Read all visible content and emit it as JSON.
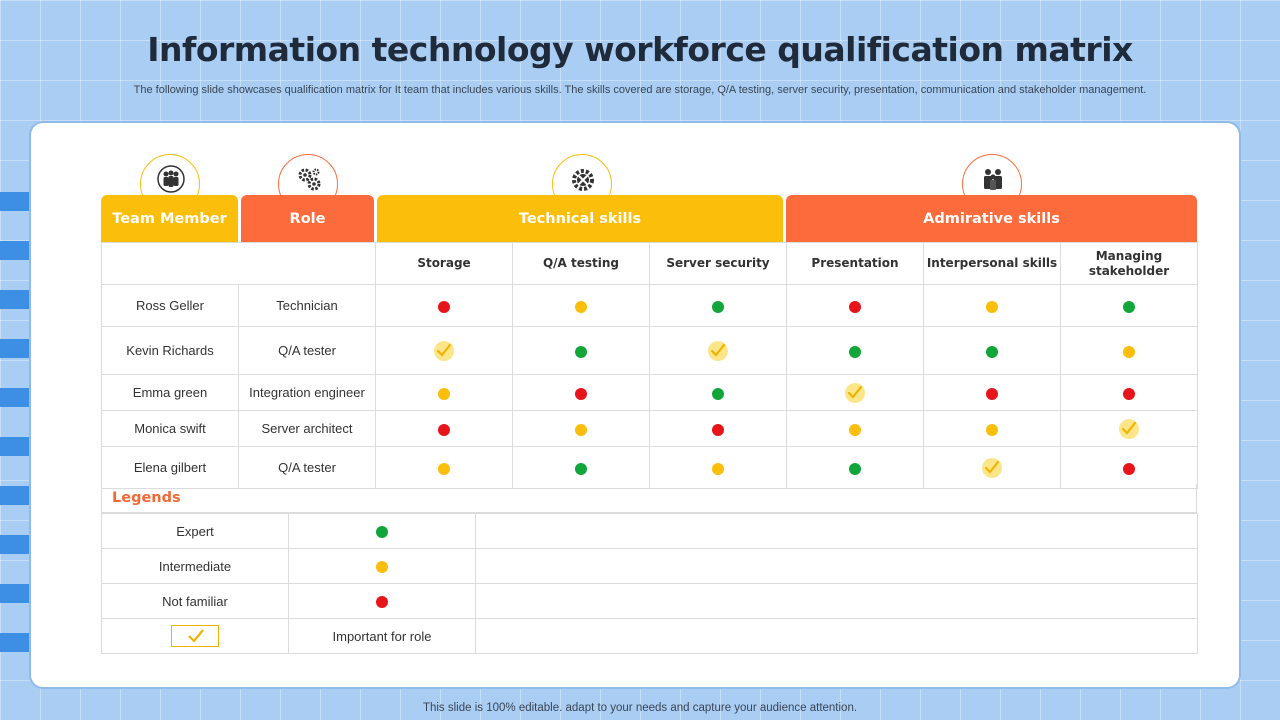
{
  "title": "Information technology workforce qualification matrix",
  "subtitle": "The following slide showcases qualification matrix for It team that includes various skills. The skills covered are storage, Q/A testing, server security, presentation, communication and stakeholder management.",
  "footer": "This slide is 100% editable. adapt to your needs and capture your audience attention.",
  "headers": {
    "team_member": "Team Member",
    "role": "Role",
    "technical": "Technical skills",
    "admin": "Admirative skills"
  },
  "skills": [
    "Storage",
    "Q/A testing",
    "Server security",
    "Presentation",
    "Interpersonal skills",
    "Managing stakeholder"
  ],
  "rows": [
    {
      "name": "Ross Geller",
      "role": "Technician",
      "levels": [
        "notfamiliar",
        "intermediate",
        "expert",
        "notfamiliar",
        "intermediate",
        "expert"
      ]
    },
    {
      "name": "Kevin Richards",
      "role": "Q/A tester",
      "levels": [
        "check",
        "expert",
        "check",
        "expert",
        "expert",
        "intermediate"
      ]
    },
    {
      "name": "Emma green",
      "role": "Integration  engineer",
      "levels": [
        "intermediate",
        "notfamiliar",
        "expert",
        "check",
        "notfamiliar",
        "notfamiliar"
      ]
    },
    {
      "name": "Monica swift",
      "role": "Server  architect",
      "levels": [
        "notfamiliar",
        "intermediate",
        "notfamiliar",
        "intermediate",
        "intermediate",
        "check"
      ]
    },
    {
      "name": "Elena gilbert",
      "role": "Q/A tester",
      "levels": [
        "intermediate",
        "expert",
        "intermediate",
        "expert",
        "check",
        "notfamiliar"
      ]
    }
  ],
  "legend": {
    "title": "Legends",
    "items": [
      {
        "label": "Expert",
        "level": "expert"
      },
      {
        "label": "Intermediate",
        "level": "intermediate"
      },
      {
        "label": "Not familiar",
        "level": "notfamiliar"
      }
    ],
    "important_label": "Important  for role"
  },
  "colors": {
    "expert": "#12a53a",
    "intermediate": "#fbbe0b",
    "notfamiliar": "#e8141b",
    "header_yellow": "#fbbe0b",
    "header_orange": "#fc6b3c"
  },
  "icons": {
    "team_member": "team-icon",
    "role": "gears-icon",
    "technical": "tools-gear-icon",
    "admin": "business-people-icon"
  }
}
